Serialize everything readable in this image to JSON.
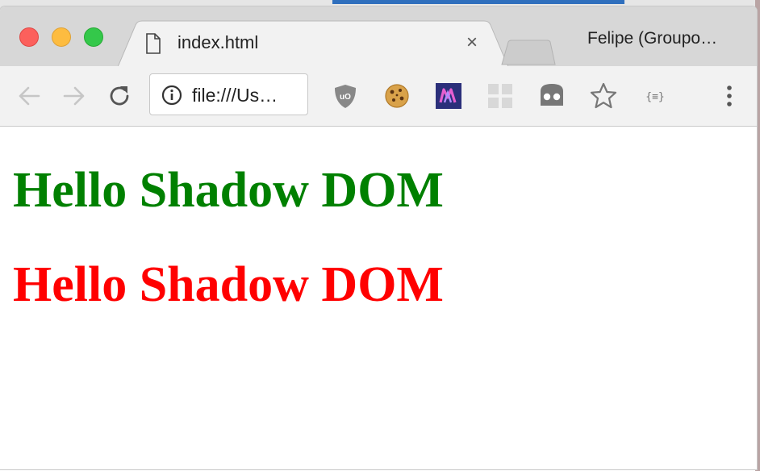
{
  "browser": {
    "tab": {
      "title": "index.html",
      "icon": "file-icon",
      "close_glyph": "×"
    },
    "profile_name": "Felipe (Groupo…",
    "address_bar": {
      "text": "file:///Us…",
      "icon": "info-icon"
    },
    "toolbar_icons": [
      "back-arrow-icon",
      "forward-arrow-icon",
      "reload-icon",
      "ublock-icon",
      "cookie-icon",
      "m-extension-icon",
      "grid-extension-icon",
      "ghost-extension-icon",
      "bookmark-star-icon",
      "json-formatter-icon",
      "more-menu-icon"
    ]
  },
  "page": {
    "headings": [
      {
        "text": "Hello Shadow DOM",
        "color": "#008000"
      },
      {
        "text": "Hello Shadow DOM",
        "color": "#ff0000"
      }
    ]
  }
}
